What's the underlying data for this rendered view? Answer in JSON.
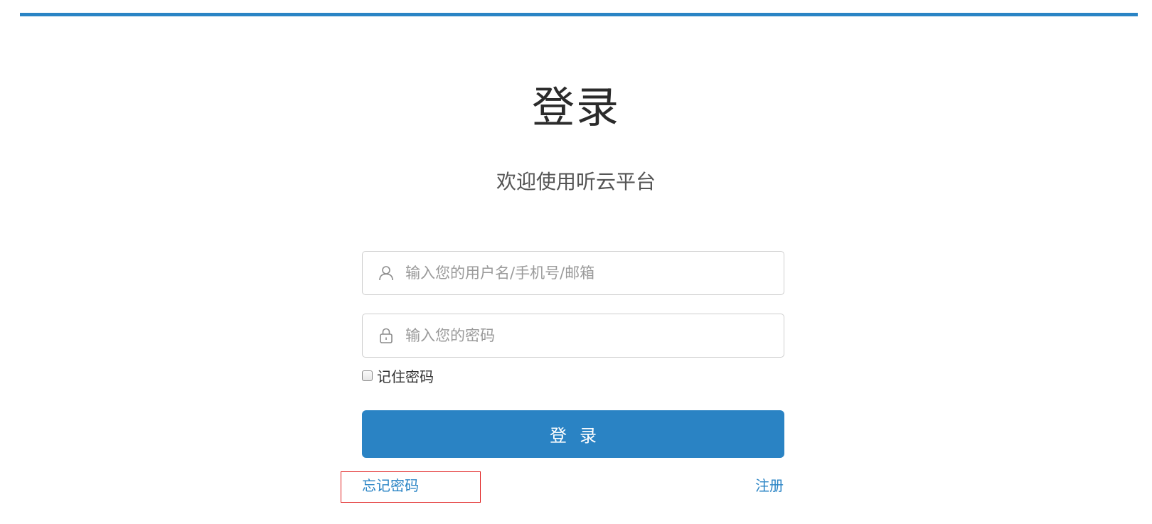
{
  "header": {
    "accent_color": "#2a84c5"
  },
  "login": {
    "title": "登录",
    "subtitle": "欢迎使用听云平台",
    "username": {
      "icon": "user-icon",
      "placeholder": "输入您的用户名/手机号/邮箱",
      "value": ""
    },
    "password": {
      "icon": "lock-icon",
      "placeholder": "输入您的密码",
      "value": ""
    },
    "remember": {
      "label": "记住密码",
      "checked": false
    },
    "submit_label": "登录",
    "button_color": "#2a83c4",
    "forgot_label": "忘记密码",
    "register_label": "注册",
    "highlight_color": "#e02020"
  }
}
